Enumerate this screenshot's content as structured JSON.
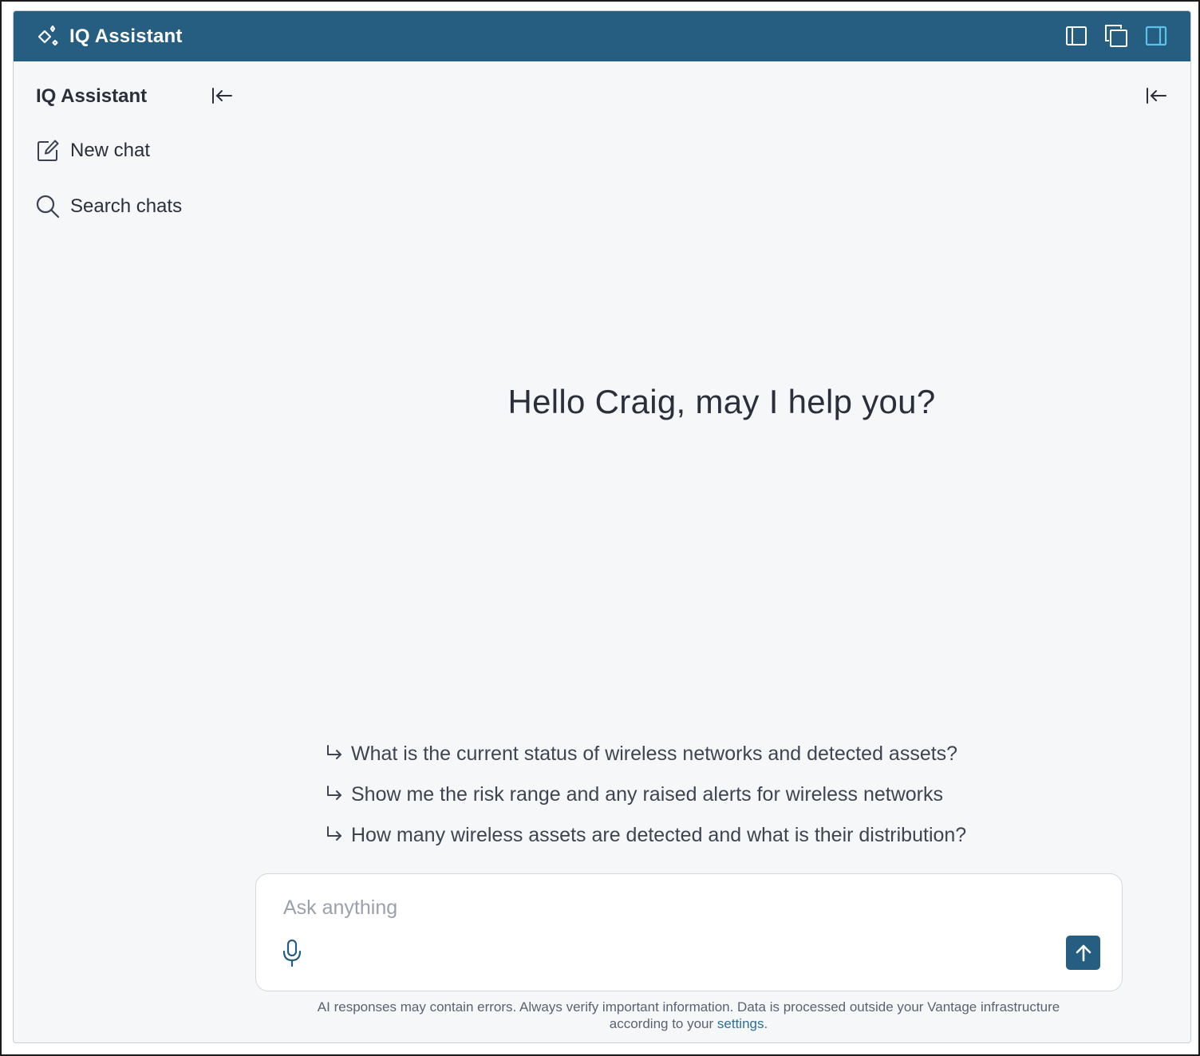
{
  "titlebar": {
    "title": "IQ Assistant",
    "icon": "sparkle-diamond-icon",
    "actions": [
      {
        "name": "sidebar-layout-icon",
        "active": false
      },
      {
        "name": "popout-window-icon",
        "active": false
      },
      {
        "name": "right-panel-layout-icon",
        "active": true
      }
    ]
  },
  "sidebar": {
    "title": "IQ Assistant",
    "items": [
      {
        "label": "New chat",
        "icon": "edit-square-icon"
      },
      {
        "label": "Search chats",
        "icon": "search-icon"
      }
    ]
  },
  "main": {
    "greeting": "Hello Craig, may I help you?",
    "suggestions": [
      "What is the current status of wireless networks and detected assets?",
      "Show me the risk range and any raised alerts for wireless networks",
      "How many wireless assets are detected and what is their distribution?"
    ]
  },
  "composer": {
    "placeholder": "Ask anything",
    "value": ""
  },
  "disclaimer": {
    "text_line1": "AI responses may contain errors. Always verify important information. Data is processed outside your Vantage infrastructure",
    "text_line2_prefix": "according to your ",
    "link": "settings",
    "suffix": "."
  },
  "colors": {
    "header": "#255e80",
    "background": "#f5f7f9",
    "accent_active": "#5bc3ea",
    "link": "#2f6e95"
  }
}
